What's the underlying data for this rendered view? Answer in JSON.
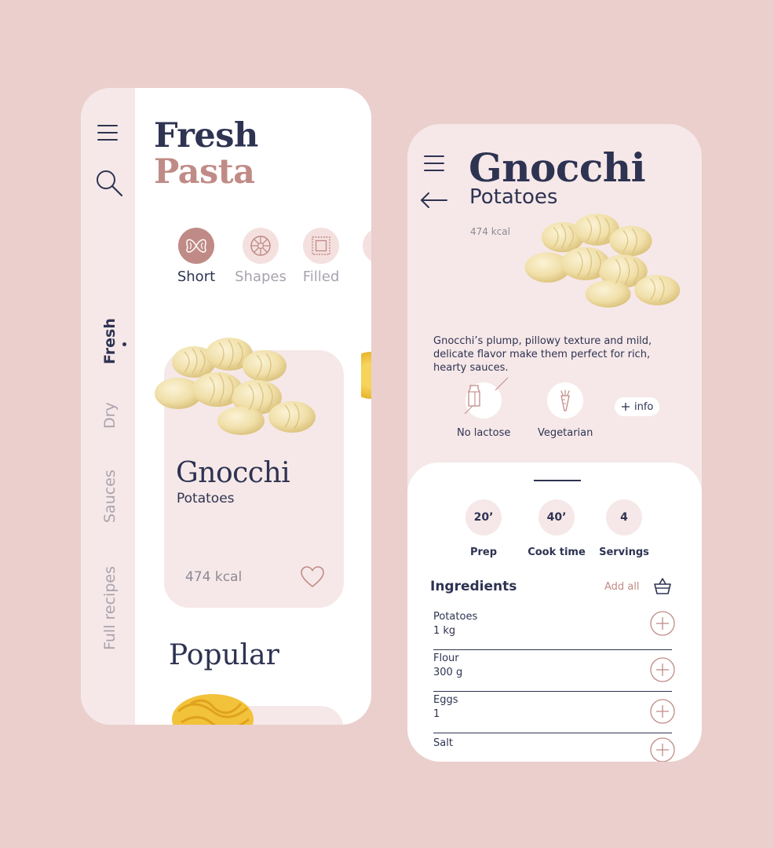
{
  "left_screen": {
    "title_line1": "Fresh",
    "title_line2": "Pasta",
    "rail_tabs": [
      {
        "label": "Fresh",
        "active": true
      },
      {
        "label": "Dry",
        "active": false
      },
      {
        "label": "Sauces",
        "active": false
      },
      {
        "label": "Full recipes",
        "active": false
      }
    ],
    "categories": [
      {
        "label": "Short",
        "icon": "farfalle-icon",
        "active": true
      },
      {
        "label": "Shapes",
        "icon": "wheel-pasta-icon",
        "active": false
      },
      {
        "label": "Filled",
        "icon": "ravioli-icon",
        "active": false
      },
      {
        "label": "Lo",
        "icon": "long-pasta-icon",
        "active": false
      }
    ],
    "featured": {
      "name": "Gnocchi",
      "subtitle": "Potatoes",
      "kcal": "474 kcal"
    },
    "popular_heading": "Popular"
  },
  "right_screen": {
    "title": "Gnocchi",
    "subtitle": "Potatoes",
    "kcal": "474 kcal",
    "description": "Gnocchi’s plump, pillowy texture and mild, delicate flavor make them perfect for rich, hearty sauces.",
    "diet_tags": [
      {
        "label": "No lactose",
        "icon": "milk-carton-icon"
      },
      {
        "label": "Vegetarian",
        "icon": "carrot-icon"
      }
    ],
    "info_label": "info",
    "stats": [
      {
        "value": "20’",
        "label": "Prep"
      },
      {
        "value": "40’",
        "label": "Cook time"
      },
      {
        "value": "4",
        "label": "Servings"
      }
    ],
    "ingredients_heading": "Ingredients",
    "add_all_label": "Add all",
    "ingredients": [
      {
        "name": "Potatoes",
        "qty": "1 kg"
      },
      {
        "name": "Flour",
        "qty": "300 g"
      },
      {
        "name": "Eggs",
        "qty": "1"
      },
      {
        "name": "Salt",
        "qty": ""
      }
    ]
  },
  "colors": {
    "background": "#EACFCD",
    "navy": "#2E3352",
    "rose": "#C08B86",
    "blush": "#F6E8E8",
    "muted": "#A9A3AE"
  }
}
